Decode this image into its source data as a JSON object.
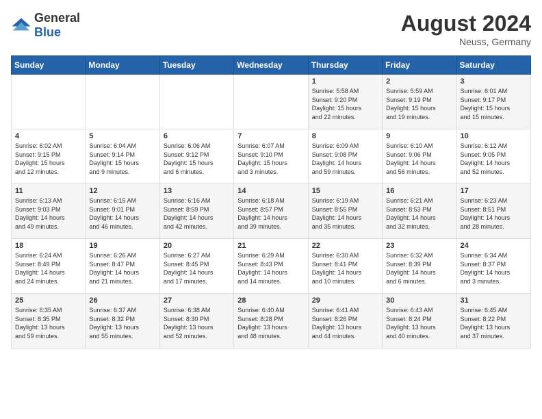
{
  "header": {
    "logo_general": "General",
    "logo_blue": "Blue",
    "month_year": "August 2024",
    "location": "Neuss, Germany"
  },
  "weekdays": [
    "Sunday",
    "Monday",
    "Tuesday",
    "Wednesday",
    "Thursday",
    "Friday",
    "Saturday"
  ],
  "weeks": [
    [
      {
        "day": "",
        "info": ""
      },
      {
        "day": "",
        "info": ""
      },
      {
        "day": "",
        "info": ""
      },
      {
        "day": "",
        "info": ""
      },
      {
        "day": "1",
        "info": "Sunrise: 5:58 AM\nSunset: 9:20 PM\nDaylight: 15 hours\nand 22 minutes."
      },
      {
        "day": "2",
        "info": "Sunrise: 5:59 AM\nSunset: 9:19 PM\nDaylight: 15 hours\nand 19 minutes."
      },
      {
        "day": "3",
        "info": "Sunrise: 6:01 AM\nSunset: 9:17 PM\nDaylight: 15 hours\nand 15 minutes."
      }
    ],
    [
      {
        "day": "4",
        "info": "Sunrise: 6:02 AM\nSunset: 9:15 PM\nDaylight: 15 hours\nand 12 minutes."
      },
      {
        "day": "5",
        "info": "Sunrise: 6:04 AM\nSunset: 9:14 PM\nDaylight: 15 hours\nand 9 minutes."
      },
      {
        "day": "6",
        "info": "Sunrise: 6:06 AM\nSunset: 9:12 PM\nDaylight: 15 hours\nand 6 minutes."
      },
      {
        "day": "7",
        "info": "Sunrise: 6:07 AM\nSunset: 9:10 PM\nDaylight: 15 hours\nand 3 minutes."
      },
      {
        "day": "8",
        "info": "Sunrise: 6:09 AM\nSunset: 9:08 PM\nDaylight: 14 hours\nand 59 minutes."
      },
      {
        "day": "9",
        "info": "Sunrise: 6:10 AM\nSunset: 9:06 PM\nDaylight: 14 hours\nand 56 minutes."
      },
      {
        "day": "10",
        "info": "Sunrise: 6:12 AM\nSunset: 9:05 PM\nDaylight: 14 hours\nand 52 minutes."
      }
    ],
    [
      {
        "day": "11",
        "info": "Sunrise: 6:13 AM\nSunset: 9:03 PM\nDaylight: 14 hours\nand 49 minutes."
      },
      {
        "day": "12",
        "info": "Sunrise: 6:15 AM\nSunset: 9:01 PM\nDaylight: 14 hours\nand 46 minutes."
      },
      {
        "day": "13",
        "info": "Sunrise: 6:16 AM\nSunset: 8:59 PM\nDaylight: 14 hours\nand 42 minutes."
      },
      {
        "day": "14",
        "info": "Sunrise: 6:18 AM\nSunset: 8:57 PM\nDaylight: 14 hours\nand 39 minutes."
      },
      {
        "day": "15",
        "info": "Sunrise: 6:19 AM\nSunset: 8:55 PM\nDaylight: 14 hours\nand 35 minutes."
      },
      {
        "day": "16",
        "info": "Sunrise: 6:21 AM\nSunset: 8:53 PM\nDaylight: 14 hours\nand 32 minutes."
      },
      {
        "day": "17",
        "info": "Sunrise: 6:23 AM\nSunset: 8:51 PM\nDaylight: 14 hours\nand 28 minutes."
      }
    ],
    [
      {
        "day": "18",
        "info": "Sunrise: 6:24 AM\nSunset: 8:49 PM\nDaylight: 14 hours\nand 24 minutes."
      },
      {
        "day": "19",
        "info": "Sunrise: 6:26 AM\nSunset: 8:47 PM\nDaylight: 14 hours\nand 21 minutes."
      },
      {
        "day": "20",
        "info": "Sunrise: 6:27 AM\nSunset: 8:45 PM\nDaylight: 14 hours\nand 17 minutes."
      },
      {
        "day": "21",
        "info": "Sunrise: 6:29 AM\nSunset: 8:43 PM\nDaylight: 14 hours\nand 14 minutes."
      },
      {
        "day": "22",
        "info": "Sunrise: 6:30 AM\nSunset: 8:41 PM\nDaylight: 14 hours\nand 10 minutes."
      },
      {
        "day": "23",
        "info": "Sunrise: 6:32 AM\nSunset: 8:39 PM\nDaylight: 14 hours\nand 6 minutes."
      },
      {
        "day": "24",
        "info": "Sunrise: 6:34 AM\nSunset: 8:37 PM\nDaylight: 14 hours\nand 3 minutes."
      }
    ],
    [
      {
        "day": "25",
        "info": "Sunrise: 6:35 AM\nSunset: 8:35 PM\nDaylight: 13 hours\nand 59 minutes."
      },
      {
        "day": "26",
        "info": "Sunrise: 6:37 AM\nSunset: 8:32 PM\nDaylight: 13 hours\nand 55 minutes."
      },
      {
        "day": "27",
        "info": "Sunrise: 6:38 AM\nSunset: 8:30 PM\nDaylight: 13 hours\nand 52 minutes."
      },
      {
        "day": "28",
        "info": "Sunrise: 6:40 AM\nSunset: 8:28 PM\nDaylight: 13 hours\nand 48 minutes."
      },
      {
        "day": "29",
        "info": "Sunrise: 6:41 AM\nSunset: 8:26 PM\nDaylight: 13 hours\nand 44 minutes."
      },
      {
        "day": "30",
        "info": "Sunrise: 6:43 AM\nSunset: 8:24 PM\nDaylight: 13 hours\nand 40 minutes."
      },
      {
        "day": "31",
        "info": "Sunrise: 6:45 AM\nSunset: 8:22 PM\nDaylight: 13 hours\nand 37 minutes."
      }
    ]
  ]
}
